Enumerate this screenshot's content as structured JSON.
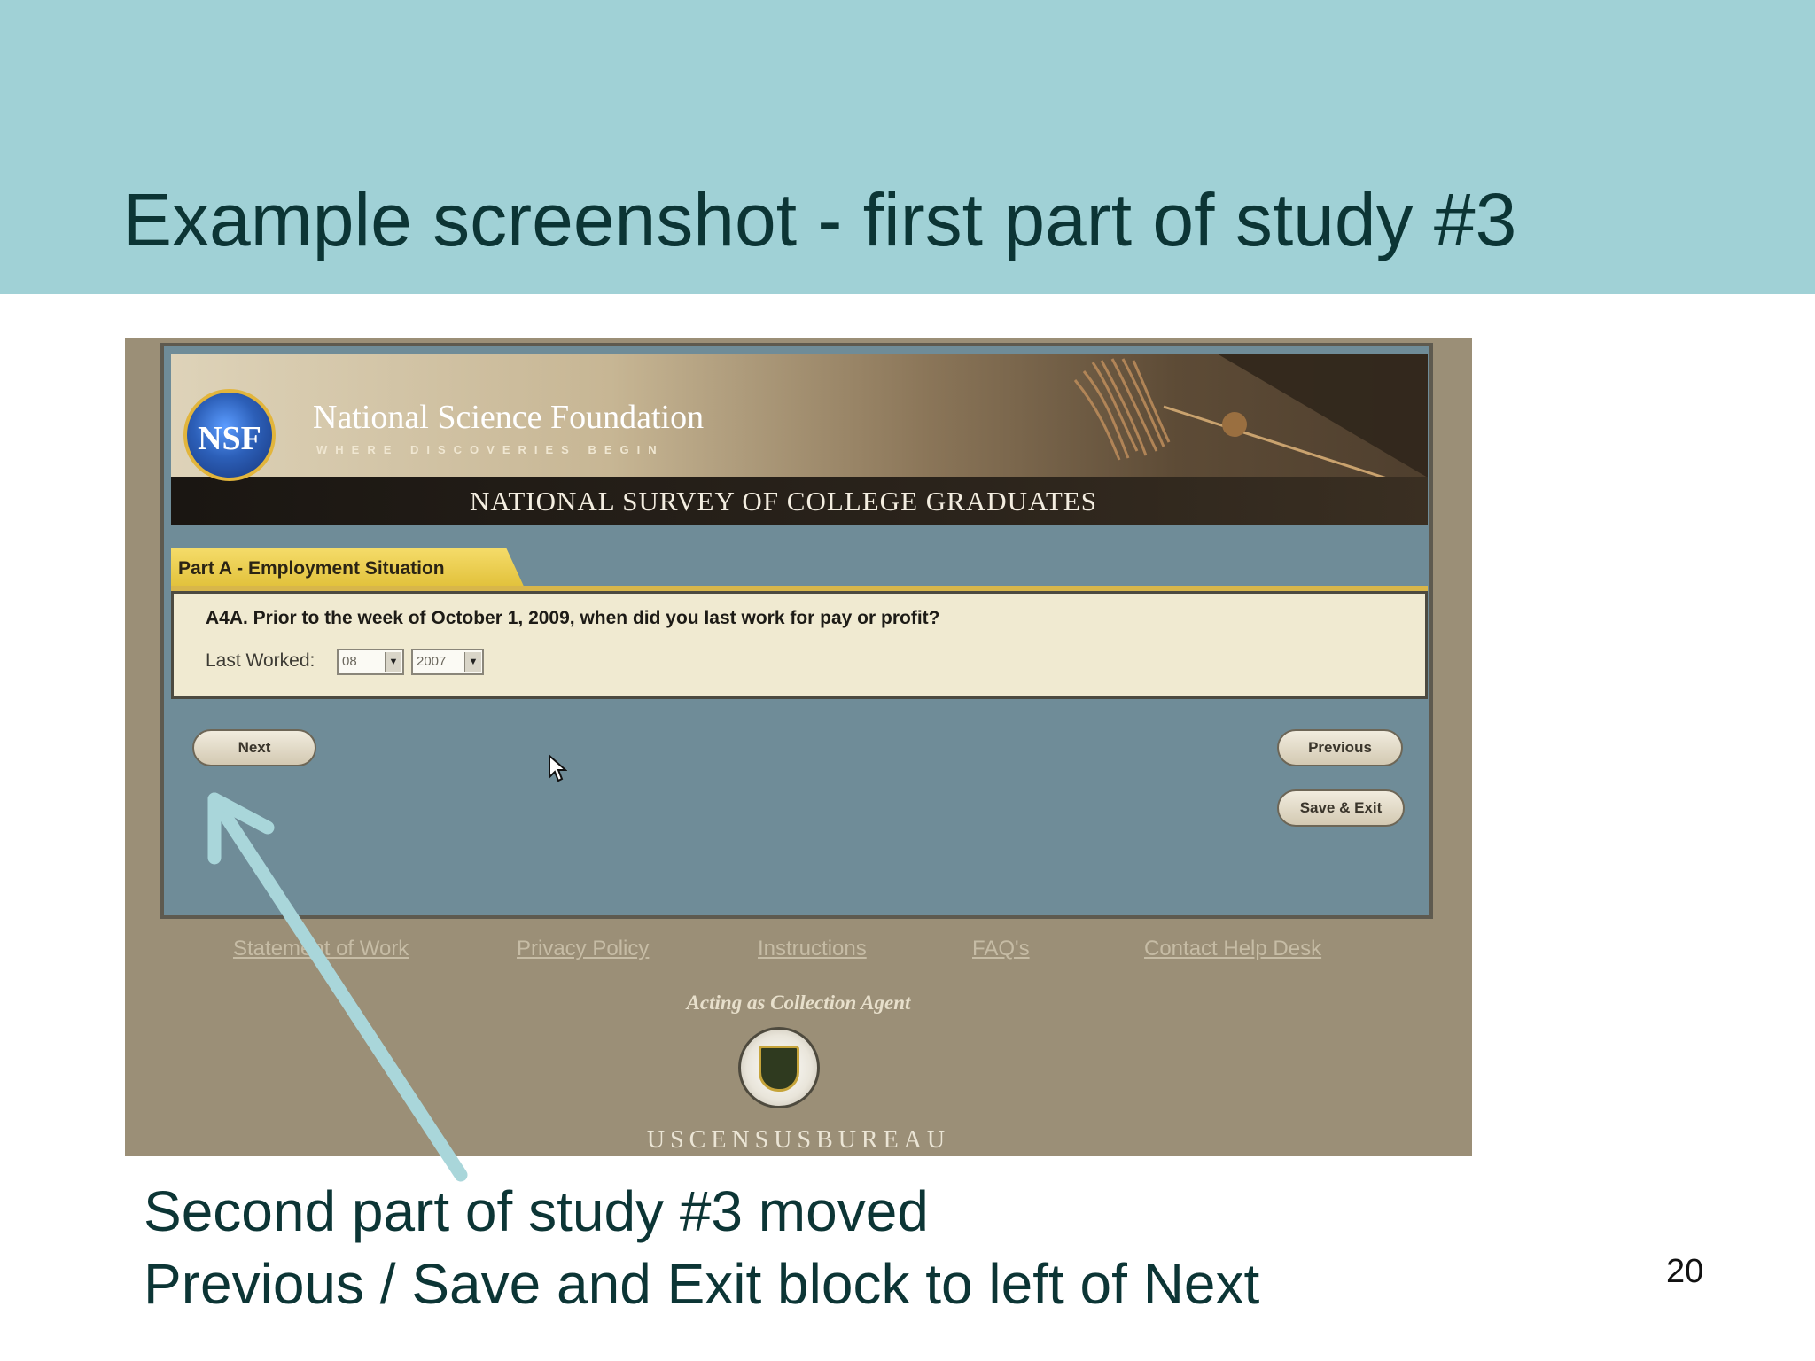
{
  "slide": {
    "title": "Example screenshot - first part of study #3",
    "caption_line1": "Second part of study #3 moved",
    "caption_line2": "Previous / Save and Exit block to left of Next",
    "page_number": "20"
  },
  "survey": {
    "nsf_seal_text": "NSF",
    "org_name": "National Science Foundation",
    "tagline": "WHERE DISCOVERIES BEGIN",
    "survey_title": "NATIONAL SURVEY OF COLLEGE GRADUATES",
    "section_tab": "Part A - Employment Situation",
    "question": "A4A. Prior to the week of October 1, 2009, when did you last work for pay or profit?",
    "field_label": "Last Worked:",
    "month_value": "08",
    "year_value": "2007",
    "next_label": "Next",
    "previous_label": "Previous",
    "save_exit_label": "Save & Exit",
    "footer_links": [
      "Statement of Work",
      "Privacy Policy",
      "Instructions",
      "FAQ's",
      "Contact Help Desk"
    ],
    "agent_text": "Acting as Collection Agent",
    "census_name": "USCENSUSBUREAU"
  },
  "colors": {
    "title_band": "#a0d1d6",
    "title_text": "#0c3535",
    "survey_body": "#6f8c98",
    "tab_yellow": "#e0bf37",
    "question_panel": "#f0ead1",
    "annotation_arrow": "#a9d6da"
  }
}
